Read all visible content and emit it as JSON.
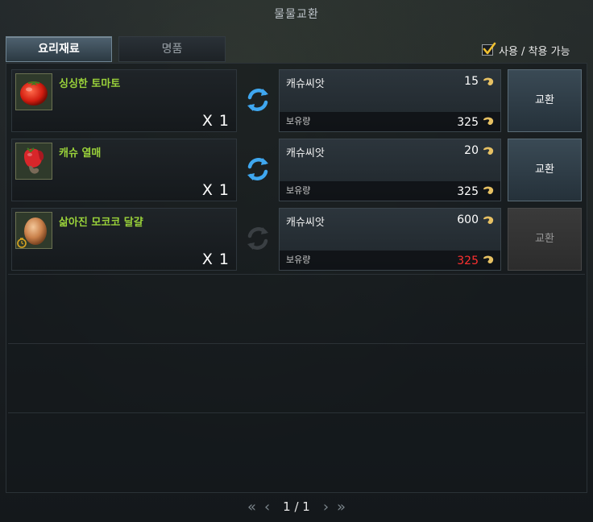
{
  "window": {
    "title": "물물교환"
  },
  "tabs": [
    {
      "label": "요리재료",
      "active": true
    },
    {
      "label": "명품",
      "active": false
    }
  ],
  "filter": {
    "label": "사용 / 착용 가능",
    "checked": true
  },
  "trades": [
    {
      "item_name": "싱싱한 토마토",
      "item_icon": "tomato-icon",
      "quantity": "X 1",
      "currency_name": "캐슈씨앗",
      "cost": "15",
      "owned_label": "보유량",
      "owned": "325",
      "affordable": true,
      "button": "교환"
    },
    {
      "item_name": "캐슈 열매",
      "item_icon": "cashew-fruit-icon",
      "quantity": "X 1",
      "currency_name": "캐슈씨앗",
      "cost": "20",
      "owned_label": "보유량",
      "owned": "325",
      "affordable": true,
      "button": "교환"
    },
    {
      "item_name": "삶아진 모코코 달걀",
      "item_icon": "egg-icon",
      "quantity": "X 1",
      "currency_name": "캐슈씨앗",
      "cost": "600",
      "owned_label": "보유량",
      "owned": "325",
      "affordable": false,
      "button": "교환"
    }
  ],
  "pagination": {
    "current": "1 / 1"
  },
  "colors": {
    "item_name": "#9ad23a",
    "insufficient": "#ff3030",
    "accent_tab": "#4f6270"
  }
}
